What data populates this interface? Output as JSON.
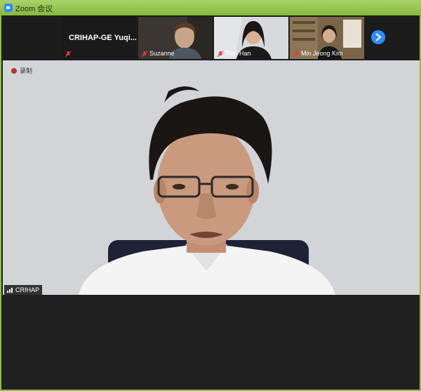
{
  "window": {
    "title": "Zoom 会议"
  },
  "participants": [
    {
      "name": "CRIHAP-GE  Yuqi...",
      "muted": true
    },
    {
      "name": "Suzanne",
      "muted": true
    },
    {
      "name": "Thiri Han",
      "muted": true
    },
    {
      "name": "Min Jeong Kim",
      "muted": true
    }
  ],
  "recording": {
    "label": "录制"
  },
  "main_speaker": {
    "name": "CRIHAP"
  },
  "colors": {
    "accent": "#2d8cff",
    "titlebar": "#8fbf46",
    "mute": "#e53935"
  }
}
